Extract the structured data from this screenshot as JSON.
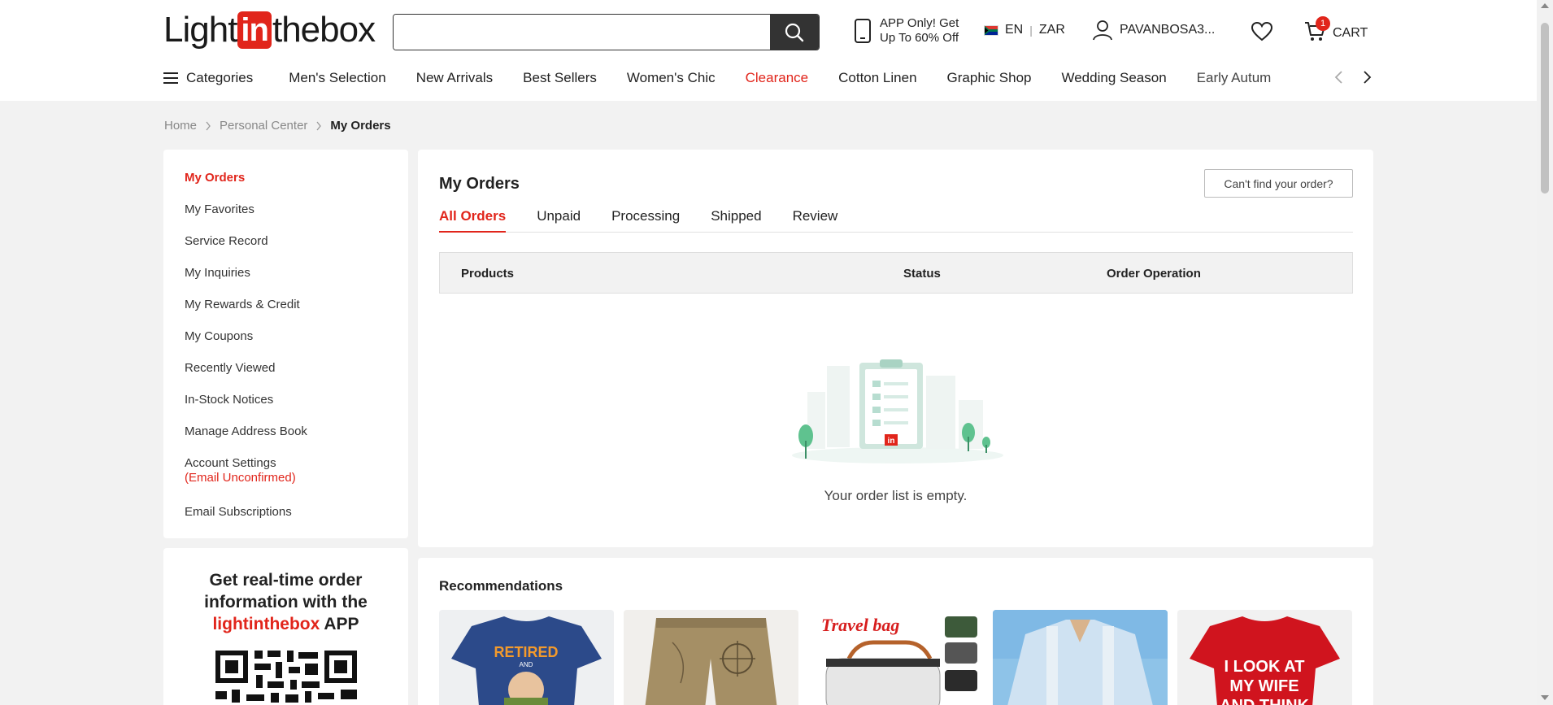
{
  "header": {
    "logo": {
      "pre": "Light",
      "in": "in",
      "post": "thebox"
    },
    "search": {
      "value": "",
      "placeholder": ""
    },
    "app_promo": {
      "line1": "APP Only! Get",
      "line2": "Up To 60% Off"
    },
    "language": "EN",
    "currency": "ZAR",
    "username": "PAVANBOSA3...",
    "cart_count": "1",
    "cart_label": "CART"
  },
  "nav": {
    "categories_label": "Categories",
    "items": [
      "Men's Selection",
      "New Arrivals",
      "Best Sellers",
      "Women's Chic",
      "Clearance",
      "Cotton Linen",
      "Graphic Shop",
      "Wedding Season",
      "Early Autum"
    ]
  },
  "breadcrumb": {
    "home": "Home",
    "personal_center": "Personal Center",
    "current": "My Orders"
  },
  "sidebar": {
    "items": [
      "My Orders",
      "My Favorites",
      "Service Record",
      "My Inquiries",
      "My Rewards & Credit",
      "My Coupons",
      "Recently Viewed",
      "In-Stock Notices",
      "Manage Address Book",
      "Account Settings",
      "Email Subscriptions"
    ],
    "account_warning": "(Email Unconfirmed)"
  },
  "app_box": {
    "line1": "Get real-time order",
    "line2": "information with the",
    "brand": "lightinthebox",
    "app": " APP"
  },
  "orders": {
    "title": "My Orders",
    "find_button": "Can't find your order?",
    "tabs": [
      "All Orders",
      "Unpaid",
      "Processing",
      "Shipped",
      "Review"
    ],
    "columns": [
      "Products",
      "Status",
      "Order Operation"
    ],
    "empty_message": "Your order list is empty."
  },
  "recommendations": {
    "title": "Recommendations",
    "cards": [
      {
        "name": "retired-tshirt",
        "caption_top": "RETIRED",
        "caption_mid": "AND"
      },
      {
        "name": "compass-shorts"
      },
      {
        "name": "travel-bag",
        "caption_top": "Travel bag"
      },
      {
        "name": "striped-shirt"
      },
      {
        "name": "red-tshirt",
        "caption_top": "I LOOK AT",
        "caption_mid": "MY WIFE",
        "caption_bot": "AND THINK"
      }
    ]
  },
  "colors": {
    "brand_red": "#e1251b",
    "dark": "#333333"
  }
}
